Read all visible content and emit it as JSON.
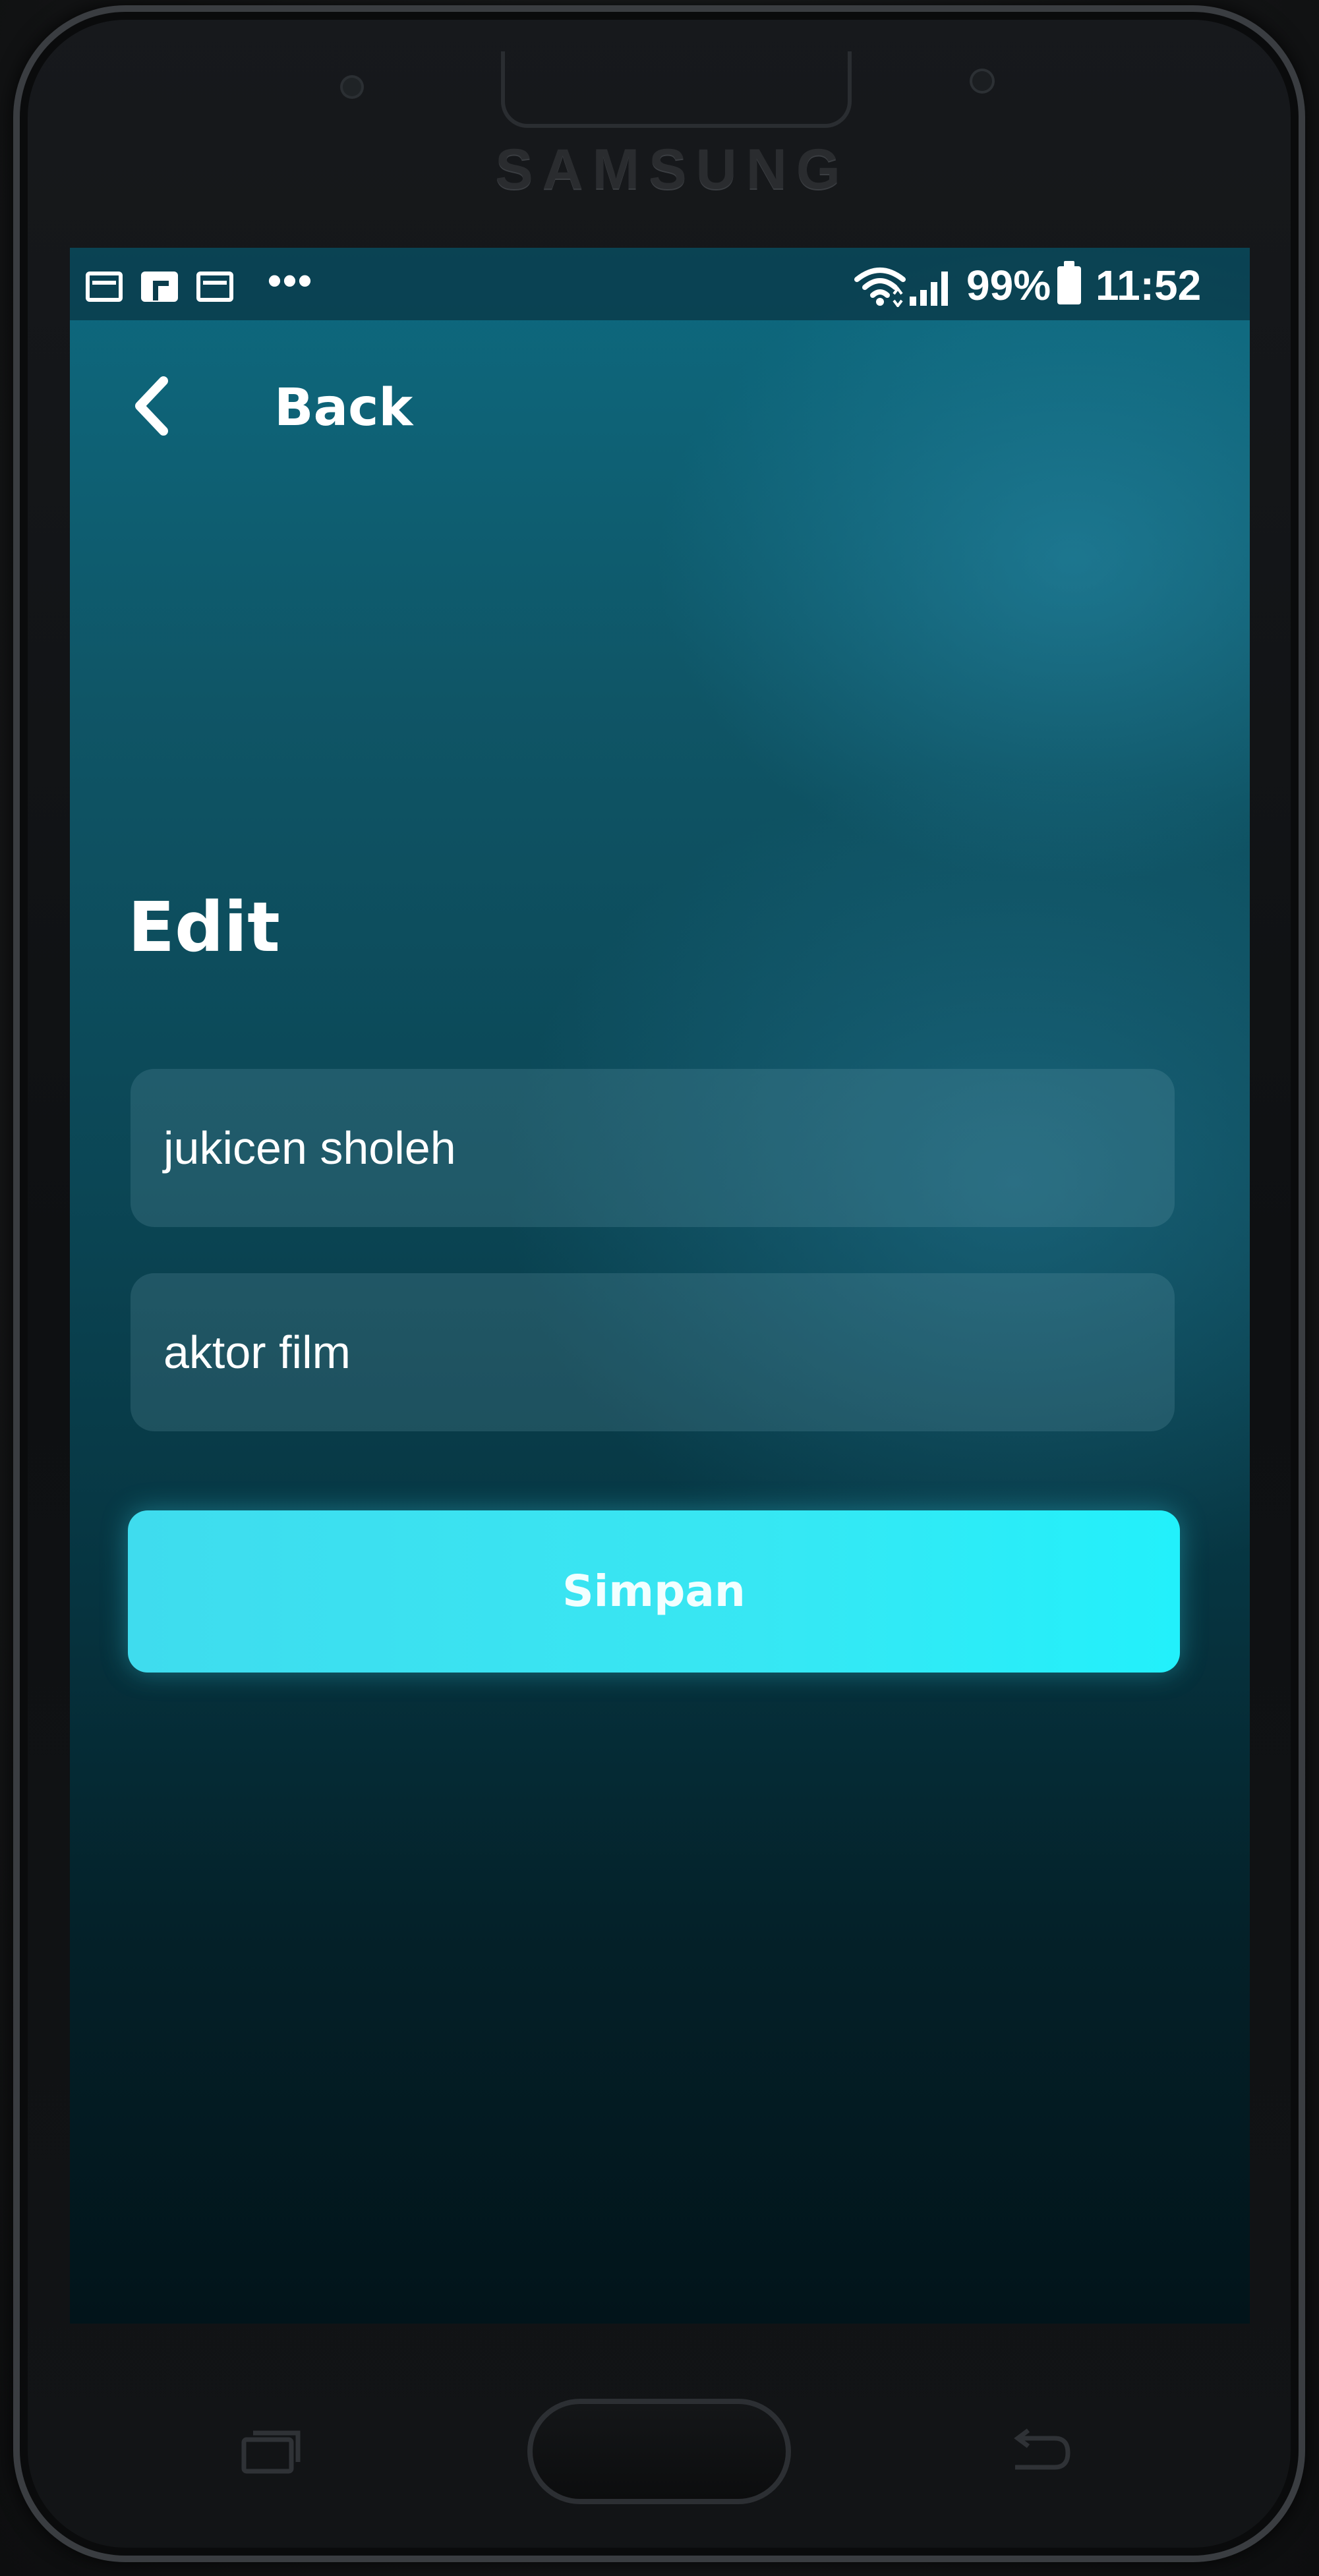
{
  "device": {
    "brand": "SAMSUNG"
  },
  "status_bar": {
    "notification_icons": [
      "calendar-icon",
      "flipboard-icon",
      "calendar-icon"
    ],
    "more_indicator": "•••",
    "battery_percent": "99%",
    "time": "11:52",
    "icons": [
      "wifi-icon",
      "signal-icon",
      "battery-icon"
    ]
  },
  "header": {
    "back_label": "Back",
    "back_icon": "chevron-left-icon"
  },
  "main": {
    "title": "Edit",
    "fields": [
      {
        "value": "jukicen sholeh"
      },
      {
        "value": "aktor film"
      }
    ],
    "save_label": "Simpan"
  },
  "colors": {
    "accent_button": "#37e7f3",
    "background_top": "#0d6a80",
    "background_bottom": "#02141a",
    "text": "#ffffff"
  }
}
